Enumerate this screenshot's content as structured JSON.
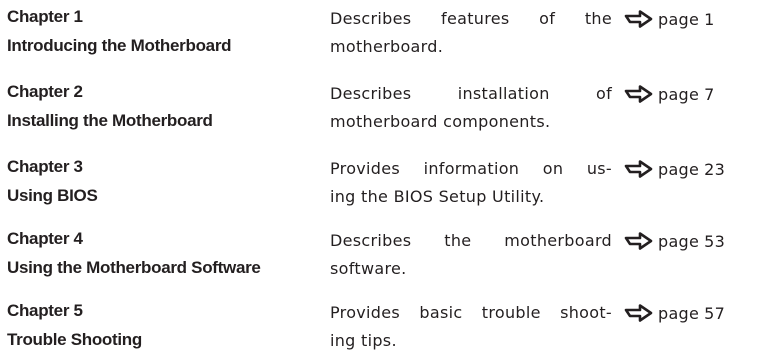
{
  "chapters": [
    {
      "number": "Chapter 1",
      "title": "Introducing the Motherboard",
      "description_lines": [
        "Describes features of the",
        "motherboard."
      ],
      "page_label": "page",
      "page_number": "1",
      "arrow_icon": "arrow-right-icon"
    },
    {
      "number": "Chapter 2",
      "title": "Installing the Motherboard",
      "description_lines": [
        "Describes installation of",
        "motherboard components."
      ],
      "page_label": "page",
      "page_number": "7",
      "arrow_icon": "arrow-right-icon"
    },
    {
      "number": "Chapter 3",
      "title": "Using BIOS",
      "description_lines": [
        "Provides information on us-",
        "ing the BIOS Setup Utility."
      ],
      "page_label": "page",
      "page_number": "23",
      "arrow_icon": "arrow-right-icon"
    },
    {
      "number": "Chapter 4",
      "title": "Using the Motherboard Software",
      "description_lines": [
        "Describes the motherboard",
        "software."
      ],
      "page_label": "page",
      "page_number": "53",
      "arrow_icon": "arrow-right-icon"
    },
    {
      "number": "Chapter 5",
      "title": "Trouble Shooting",
      "description_lines": [
        "Provides basic trouble shoot-",
        "ing tips."
      ],
      "page_label": "page",
      "page_number": "57",
      "arrow_icon": "arrow-right-icon"
    }
  ]
}
